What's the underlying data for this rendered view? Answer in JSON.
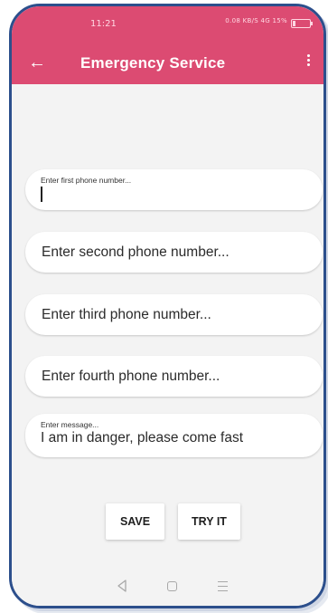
{
  "status_bar": {
    "time": "11:21",
    "indicators": "0.08 KB/S  4G  15%",
    "battery_icon": "battery-low-icon"
  },
  "app_bar": {
    "title": "Emergency Service",
    "back_icon": "arrow-left-icon",
    "more_icon": "more-vertical-icon",
    "color": "#dc4b72"
  },
  "form": {
    "first_phone": {
      "label": "Enter first phone number...",
      "value": ""
    },
    "second_phone": {
      "placeholder": "Enter second phone number...",
      "value": ""
    },
    "third_phone": {
      "placeholder": "Enter third phone number...",
      "value": ""
    },
    "fourth_phone": {
      "placeholder": "Enter fourth phone number...",
      "value": ""
    },
    "message": {
      "label": "Enter message...",
      "value": "I am in danger, please come fast"
    }
  },
  "buttons": {
    "save": "SAVE",
    "try_it": "TRY IT"
  },
  "nav_bar": {
    "back_icon": "nav-back-icon",
    "home_icon": "nav-home-icon",
    "menu_icon": "nav-menu-icon"
  }
}
